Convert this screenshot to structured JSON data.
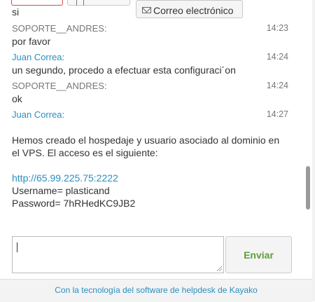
{
  "toolbar": {
    "email_tab_label": "Correo electrónico",
    "cut_text": "si"
  },
  "messages": [
    {
      "sender": "SOPORTE__ANDRES:",
      "role": "support",
      "time": "14:23",
      "lines": [
        "por favor"
      ]
    },
    {
      "sender": "Juan Correa:",
      "role": "agent",
      "time": "14:24",
      "lines": [
        "un segundo, procedo a efectuar esta configuraci´on"
      ]
    },
    {
      "sender": "SOPORTE__ANDRES:",
      "role": "support",
      "time": "14:24",
      "lines": [
        "ok"
      ]
    },
    {
      "sender": "Juan Correa:",
      "role": "agent",
      "time": "14:27",
      "lines": []
    }
  ],
  "long_message": {
    "paragraph_line1": "Hemos creado el hospedaje y usuario asociado al dominio en",
    "paragraph_line2": "el VPS. El acceso es el siguiente:",
    "url": "http://65.99.225.75:2222",
    "username_line": "Username= plasticand",
    "password_line": "Password= 7hRHedKC9JB2"
  },
  "composer": {
    "value": "",
    "send_label": "Enviar"
  },
  "footer": {
    "text": "Con la tecnología del software de helpdesk de Kayako"
  },
  "colors": {
    "agent_name": "#2a8fbf",
    "support_name": "#777777",
    "send_text": "#5f9e3c",
    "footer_link": "#2a8fbf"
  }
}
